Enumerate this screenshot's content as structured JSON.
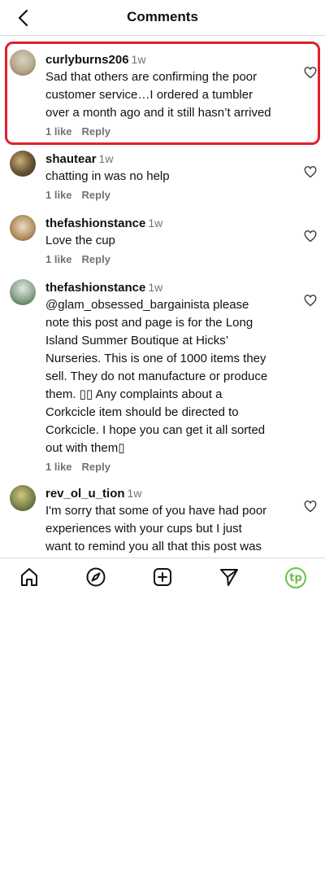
{
  "header": {
    "title": "Comments"
  },
  "comments": [
    {
      "username": "curlyburns206",
      "time": "1w",
      "text": "Sad that others are confirming the poor\ncustomer service…I ordered a tumbler\nover a month ago and it still hasn’t arrived",
      "likes": "1 like",
      "reply": "Reply"
    },
    {
      "username": "shautear",
      "time": "1w",
      "text": "chatting in was no help",
      "likes": "1 like",
      "reply": "Reply"
    },
    {
      "username": "thefashionstance",
      "time": "1w",
      "text": "Love the cup",
      "likes": "1 like",
      "reply": "Reply"
    },
    {
      "username": "thefashionstance",
      "time": "1w",
      "text": "@glam_obsessed_bargainista please\nnote this post and page is for the Long\nIsland Summer Boutique at Hicks’\nNurseries. This is one of 1000 items they\nsell. They do not manufacture or produce\nthem. ▯▯ Any complaints about a\nCorkcicle item should be directed to\nCorkcicle. I hope you can get it all sorted\nout with them▯",
      "likes": "1 like",
      "reply": "Reply"
    },
    {
      "username": "rev_ol_u_tion",
      "time": "1w",
      "text": "I'm sorry that some of you have had poor\nexperiences with your cups but I just\nwant to remind you all that this post was",
      "likes": "",
      "reply": ""
    }
  ],
  "tabbar": {
    "icons": [
      "home-icon",
      "explore-icon",
      "create-icon",
      "direct-message-icon"
    ],
    "profile_badge": "tp",
    "profile_color": "#6cc04a"
  },
  "colors": {
    "highlight": "#e0202e",
    "muted": "#737373"
  }
}
